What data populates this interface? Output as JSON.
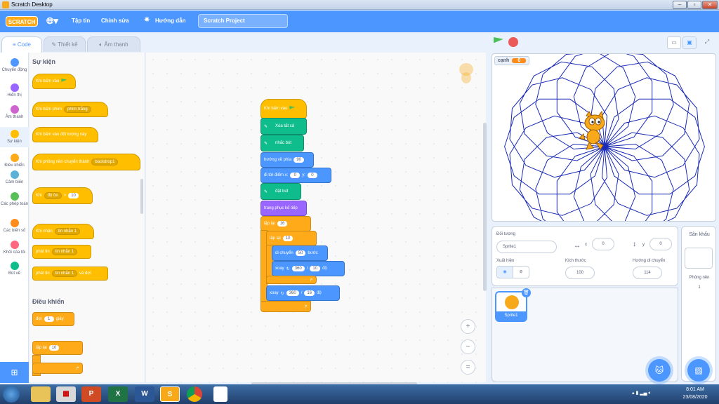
{
  "window": {
    "title": "Scratch Desktop"
  },
  "menubar": {
    "logo": "SCRATCH",
    "file": "Tập tin",
    "edit": "Chỉnh sửa",
    "tutorials": "Hướng dẫn",
    "project_title": "Scratch Project"
  },
  "tabs": {
    "code": "Code",
    "costumes": "Thiết kế",
    "sounds": "Âm thanh"
  },
  "categories": [
    {
      "label": "Chuyển động",
      "color": "#4c97ff"
    },
    {
      "label": "Hiển thị",
      "color": "#9966ff"
    },
    {
      "label": "Âm thanh",
      "color": "#cf63cf"
    },
    {
      "label": "Sự kiện",
      "color": "#ffbf00"
    },
    {
      "label": "Điều khiển",
      "color": "#ffab19"
    },
    {
      "label": "Cảm biến",
      "color": "#5cb1d6"
    },
    {
      "label": "Các phép toán",
      "color": "#59c059"
    },
    {
      "label": "Các biến số",
      "color": "#ff8c1a"
    },
    {
      "label": "Khối của tôi",
      "color": "#ff6680"
    },
    {
      "label": "Bút vẽ",
      "color": "#0fbd8c"
    }
  ],
  "palette": {
    "events_title": "Sự kiện",
    "b1": "Khi bấm vào",
    "b2": "Khi bấm phím",
    "b2_dd": "phím trắng",
    "b3": "Khi bấm vào đối tượng này",
    "b4": "Khi phông nền chuyển thành",
    "b4_dd": "backdrop1",
    "b5": "Khi",
    "b5_dd": "độ ồn",
    "b5_op": ">",
    "b5_val": "10",
    "b6": "Khi nhận",
    "b6_dd": "tin nhắn 1",
    "b7": "phát tin",
    "b7_dd": "tin nhắn 1",
    "b8": "phát tin",
    "b8_dd": "tin nhắn 1",
    "b8_tail": "và đợi",
    "control_title": "Điều khiển",
    "c1": "đợi",
    "c1_val": "1",
    "c1_tail": "giây",
    "c2": "lặp lại",
    "c2_val": "10"
  },
  "script": {
    "s1": "Khi bấm vào",
    "s2": "Xóa tất cả",
    "s3": "nhấc bút",
    "s4": "hướng về phía",
    "s4_val": "90",
    "s5": "đi tới điểm x:",
    "s5_x": "0",
    "s5_y_lbl": "y:",
    "s5_y": "0",
    "s6": "đặt bút",
    "s7": "trang phục kế tiếp",
    "s8": "lặp lại",
    "s8_val": "16",
    "s9": "lặp lại",
    "s9_val": "10",
    "s10": "di chuyển",
    "s10_val": "50",
    "s10_tail": "bước",
    "s11": "xoay",
    "s11_a": "360",
    "s11_op": "/",
    "s11_b": "10",
    "s11_tail": "độ",
    "s12": "xoay",
    "s12_a": "360",
    "s12_op": "/",
    "s12_b": "16",
    "s12_tail": "độ"
  },
  "stage": {
    "var_name": "cạnh",
    "var_value": "0"
  },
  "sprite_info": {
    "label_sprite": "Đối tượng",
    "sprite_name": "Sprite1",
    "x": "0",
    "y": "0",
    "label_show": "Xuất hiện",
    "label_size": "Kích thước",
    "size": "100",
    "label_dir": "Hướng di chuyển",
    "direction": "114"
  },
  "sprite_list": [
    {
      "name": "Sprite1"
    }
  ],
  "stage_panel": {
    "title": "Sân khấu",
    "backdrops_label": "Phông nền",
    "backdrops_count": "1"
  },
  "taskbar": {
    "time": "8:01 AM",
    "date": "23/08/2020"
  }
}
